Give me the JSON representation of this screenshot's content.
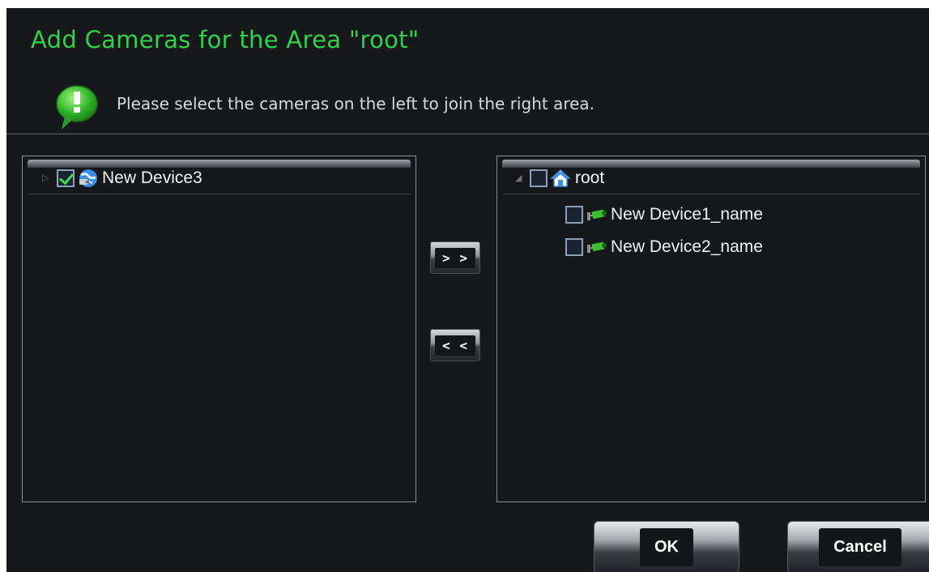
{
  "dialog": {
    "title": "Add Cameras for the Area \"root\"",
    "hint": "Please select the cameras on the left to join the right area."
  },
  "left_tree": {
    "items": [
      {
        "label": "New Device3",
        "checked": true,
        "icon": "device-globe-icon",
        "expander": "collapsed"
      }
    ]
  },
  "right_tree": {
    "root": {
      "label": "root",
      "checked": false,
      "icon": "home-icon",
      "expander": "expanded"
    },
    "children": [
      {
        "label": "New Device1_name",
        "checked": false,
        "icon": "camera-icon"
      },
      {
        "label": "New Device2_name",
        "checked": false,
        "icon": "camera-icon"
      }
    ]
  },
  "transfer": {
    "add_label": "> >",
    "remove_label": "< <"
  },
  "footer": {
    "ok_label": "OK",
    "cancel_label": "Cancel"
  },
  "colors": {
    "background": "#16181b",
    "title": "#2fd24a",
    "check": "#37e04d"
  }
}
